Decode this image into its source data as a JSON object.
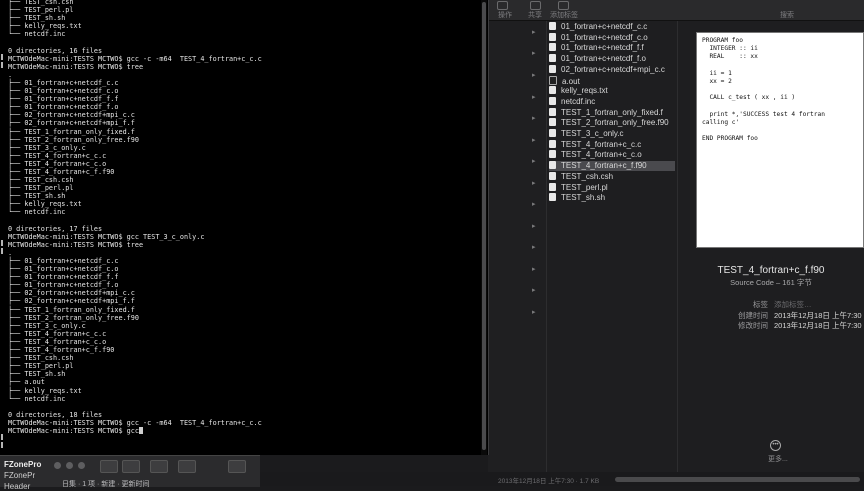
{
  "terminal": {
    "lines": [
      "├── TEST_csh.csh",
      "├── TEST_perl.pl",
      "├── TEST_sh.sh",
      "├── kelly_reqs.txt",
      "└── netcdf.inc",
      "",
      "0 directories, 16 files",
      "MCTWOdeMac-mini:TESTS MCTWO$ gcc -c -m64  TEST_4_fortran+c_c.c",
      "MCTWOdeMac-mini:TESTS MCTWO$ tree",
      ".",
      "├── 01_fortran+c+netcdf_c.c",
      "├── 01_fortran+c+netcdf_c.o",
      "├── 01_fortran+c+netcdf_f.f",
      "├── 01_fortran+c+netcdf_f.o",
      "├── 02_fortran+c+netcdf+mpi_c.c",
      "├── 02_fortran+c+netcdf+mpi_f.f",
      "├── TEST_1_fortran_only_fixed.f",
      "├── TEST_2_fortran_only_free.f90",
      "├── TEST_3_c_only.c",
      "├── TEST_4_fortran+c_c.c",
      "├── TEST_4_fortran+c_c.o",
      "├── TEST_4_fortran+c_f.f90",
      "├── TEST_csh.csh",
      "├── TEST_perl.pl",
      "├── TEST_sh.sh",
      "├── kelly_reqs.txt",
      "└── netcdf.inc",
      "",
      "0 directories, 17 files",
      "MCTWOdeMac-mini:TESTS MCTWO$ gcc TEST_3_c_only.c",
      "MCTWOdeMac-mini:TESTS MCTWO$ tree",
      ".",
      "├── 01_fortran+c+netcdf_c.c",
      "├── 01_fortran+c+netcdf_c.o",
      "├── 01_fortran+c+netcdf_f.f",
      "├── 01_fortran+c+netcdf_f.o",
      "├── 02_fortran+c+netcdf+mpi_c.c",
      "├── 02_fortran+c+netcdf+mpi_f.f",
      "├── TEST_1_fortran_only_fixed.f",
      "├── TEST_2_fortran_only_free.f90",
      "├── TEST_3_c_only.c",
      "├── TEST_4_fortran+c_c.c",
      "├── TEST_4_fortran+c_c.o",
      "├── TEST_4_fortran+c_f.f90",
      "├── TEST_csh.csh",
      "├── TEST_perl.pl",
      "├── TEST_sh.sh",
      "├── a.out",
      "├── kelly_reqs.txt",
      "└── netcdf.inc",
      "",
      "0 directories, 18 files",
      "MCTWOdeMac-mini:TESTS MCTWO$ gcc -c -m64  TEST_4_fortran+c_c.c"
    ],
    "prompt_line": "MCTWOdeMac-mini:TESTS MCTWO$ gcc"
  },
  "finder": {
    "toolbar": {
      "action_label": "操作",
      "share_label": "共享",
      "tags_label": "添加标签",
      "search_label": "搜索"
    },
    "files": [
      {
        "name": "01_fortran+c+netcdf_c.c",
        "icon": "c-source-icon"
      },
      {
        "name": "01_fortran+c+netcdf_c.o",
        "icon": "object-file-icon"
      },
      {
        "name": "01_fortran+c+netcdf_f.f",
        "icon": "fortran-file-icon"
      },
      {
        "name": "01_fortran+c+netcdf_f.o",
        "icon": "object-file-icon"
      },
      {
        "name": "02_fortran+c+netcdf+mpi_c.c",
        "icon": "c-source-icon"
      },
      {
        "name": "a.out",
        "icon": "executable-icon"
      },
      {
        "name": "kelly_reqs.txt",
        "icon": "text-file-icon"
      },
      {
        "name": "netcdf.inc",
        "icon": "document-icon"
      },
      {
        "name": "TEST_1_fortran_only_fixed.f",
        "icon": "fortran-file-icon"
      },
      {
        "name": "TEST_2_fortran_only_free.f90",
        "icon": "fortran-file-icon"
      },
      {
        "name": "TEST_3_c_only.c",
        "icon": "c-source-icon"
      },
      {
        "name": "TEST_4_fortran+c_c.c",
        "icon": "c-source-icon"
      },
      {
        "name": "TEST_4_fortran+c_c.o",
        "icon": "object-file-icon"
      },
      {
        "name": "TEST_4_fortran+c_f.f90",
        "icon": "fortran-file-icon",
        "selected": true
      },
      {
        "name": "TEST_csh.csh",
        "icon": "script-icon"
      },
      {
        "name": "TEST_perl.pl",
        "icon": "script-icon"
      },
      {
        "name": "TEST_sh.sh",
        "icon": "script-icon"
      }
    ],
    "preview": {
      "code": "PROGRAM foo\n  INTEGER :: ii\n  REAL    :: xx\n\n  ii = 1\n  xx = 2\n\n  CALL c_test ( xx , ii )\n\n  print *,'SUCCESS test 4 fortran\ncalling c'\n\nEND PROGRAM foo",
      "filename": "TEST_4_fortran+c_f.f90",
      "kind": "Source Code – 161 字节",
      "tags_key": "标签",
      "tags_placeholder": "添加标签…",
      "created_key": "创建时间",
      "created_value": "2013年12月18日 上午7:30",
      "modified_key": "修改时间",
      "modified_value": "2013年12月18日 上午7:30",
      "more_label": "更多..."
    }
  },
  "back_window": {
    "title": "FZonePro",
    "line2": "FZonePr",
    "line3": "Header",
    "extra_text": "日集 · 1 项 · 新建 · 更新时间"
  },
  "bottom_strip": {
    "text": "2013年12月18日 上午7:30 · 1.7 KB"
  },
  "colors": {
    "terminal_bg": "#000000",
    "terminal_fg": "#e6e6e6",
    "finder_bg": "#1e1e20",
    "selection": "#4a4a4e"
  }
}
